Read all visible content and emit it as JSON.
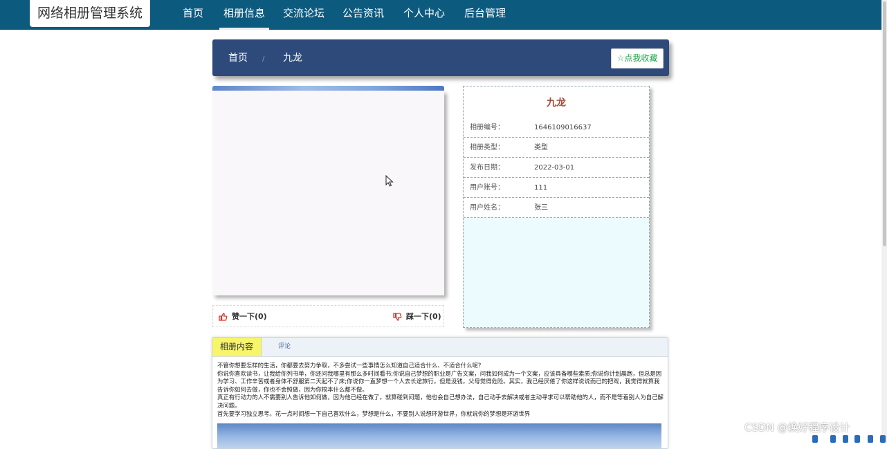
{
  "app": {
    "title": "网络相册管理系统"
  },
  "nav": {
    "items": [
      {
        "label": "首页"
      },
      {
        "label": "相册信息"
      },
      {
        "label": "交流论坛"
      },
      {
        "label": "公告资讯"
      },
      {
        "label": "个人中心"
      },
      {
        "label": "后台管理"
      }
    ],
    "active": "相册信息"
  },
  "breadcrumb": {
    "home": "首页",
    "separator": "/",
    "current": "九龙"
  },
  "favorite_button": {
    "label": "☆点我收藏"
  },
  "votes": {
    "like_label": "赞一下(0)",
    "dislike_label": "踩一下(0)"
  },
  "album": {
    "title": "九龙",
    "fields": [
      {
        "label": "相册编号：",
        "value": "1646109016637"
      },
      {
        "label": "相册类型：",
        "value": "类型"
      },
      {
        "label": "发布日期：",
        "value": "2022-03-01"
      },
      {
        "label": "用户账号：",
        "value": "111"
      },
      {
        "label": "用户姓名：",
        "value": "张三"
      }
    ]
  },
  "tabs": {
    "content": "相册内容",
    "comments": "评论"
  },
  "article": {
    "paragraphs": [
      "不管你想要怎样的生活，你都要去努力争取，不多尝试一些事情怎么知道自己适合什么、不适合什么呢?",
      "你说你喜欢读书，让我给你列书单，你还问我哪里有那么多时间看书;你说自己梦想的职业是广告文案，问我如何成为一个文案，应该具备哪些素质;你说你计划晨跑，但总是因为学习、工作辛苦或者身体不舒服第二天起不了床;你说你一直梦想一个人去长途旅行，但是没钱，父母觉得危险。其实，我已经厌倦了你这样说说而已的把戏，我觉得就算我告诉你如何去做，你也不会照做，因为你根本什么都不做。",
      "真正有行动力的人不需要别人告诉他如何做，因为他已经在做了。就算碰到问题，他也会自己想办法，自己动手去解决或者主动寻求可以帮助他的人，而不是等着别人为自己解决问题。",
      "首先要学习独立思考。花一点时间想一下自己喜欢什么，梦想是什么，不要别人说想环游世界，你就说你的梦想是环游世界"
    ]
  },
  "watermark": "CSDN @焕好程序设计",
  "colors": {
    "nav_bg": "#0d5a7f",
    "crumb_bg": "#2d4a7a",
    "accent_green": "#21a34a",
    "title_brown": "#9b4a3a"
  }
}
